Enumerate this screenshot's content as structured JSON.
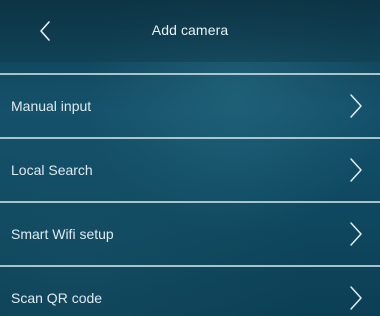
{
  "header": {
    "title": "Add camera",
    "back_icon": "chevron-left-icon"
  },
  "menu": {
    "items": [
      {
        "label": "Manual input",
        "icon": "chevron-right-icon"
      },
      {
        "label": "Local Search",
        "icon": "chevron-right-icon"
      },
      {
        "label": "Smart Wifi setup",
        "icon": "chevron-right-icon"
      },
      {
        "label": "Scan QR code",
        "icon": "chevron-right-icon"
      }
    ]
  },
  "colors": {
    "background": "#124a60",
    "divider": "#dcebf0",
    "text": "#e6f0f3"
  }
}
